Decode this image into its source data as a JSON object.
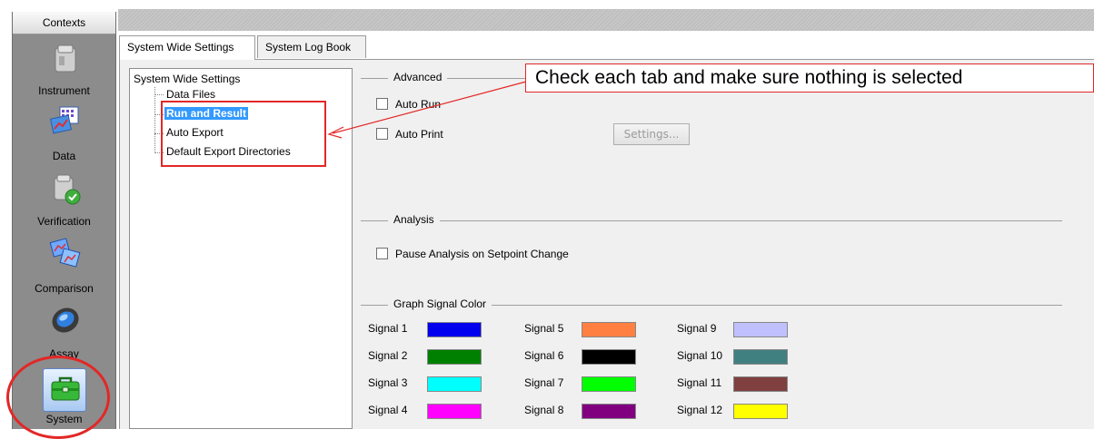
{
  "contexts": {
    "header": "Contexts",
    "items": [
      {
        "label": "Instrument",
        "icon": "instrument-icon"
      },
      {
        "label": "Data",
        "icon": "data-icon"
      },
      {
        "label": "Verification",
        "icon": "verification-icon"
      },
      {
        "label": "Comparison",
        "icon": "comparison-icon"
      },
      {
        "label": "Assay",
        "icon": "assay-icon"
      },
      {
        "label": "System",
        "icon": "toolbox-icon",
        "selected": true
      }
    ]
  },
  "tabs": [
    {
      "label": "System Wide Settings",
      "active": true
    },
    {
      "label": "System Log Book",
      "active": false
    }
  ],
  "tree": {
    "root": "System Wide Settings",
    "children": [
      "Data Files",
      "Run and Result",
      "Auto Export",
      "Default Export Directories"
    ],
    "selected": "Run and Result"
  },
  "advanced": {
    "title": "Advanced",
    "auto_run": {
      "label": "Auto Run",
      "checked": false
    },
    "auto_print": {
      "label": "Auto Print",
      "checked": false
    },
    "settings_button": "Settings..."
  },
  "analysis": {
    "title": "Analysis",
    "pause": {
      "label": "Pause Analysis on Setpoint Change",
      "checked": false
    }
  },
  "graph_signal_color": {
    "title": "Graph Signal Color",
    "signals": [
      {
        "label": "Signal 1",
        "color": "#0000ee"
      },
      {
        "label": "Signal 2",
        "color": "#008000"
      },
      {
        "label": "Signal 3",
        "color": "#00ffff"
      },
      {
        "label": "Signal 4",
        "color": "#ff00ff"
      },
      {
        "label": "Signal 5",
        "color": "#ff8040"
      },
      {
        "label": "Signal 6",
        "color": "#000000"
      },
      {
        "label": "Signal 7",
        "color": "#00ff00"
      },
      {
        "label": "Signal 8",
        "color": "#800080"
      },
      {
        "label": "Signal 9",
        "color": "#c0c0ff"
      },
      {
        "label": "Signal 10",
        "color": "#408080"
      },
      {
        "label": "Signal 11",
        "color": "#804040"
      },
      {
        "label": "Signal 12",
        "color": "#ffff00"
      }
    ]
  },
  "callout": {
    "text": "Check each tab and make sure nothing is selected",
    "color": "#e32727"
  }
}
